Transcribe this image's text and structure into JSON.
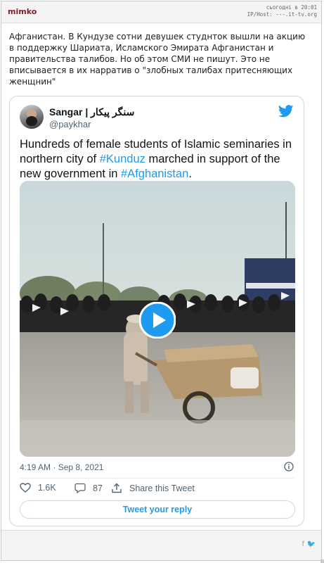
{
  "post": {
    "author": "mimko",
    "timestamp": "сьогодні в 20:01",
    "ip_host": "IP/Host: ---.it-tv.org",
    "text": "Афганистан. В Кундузе сотни девушек студнток вышли на акцию в поддержку Шариата, Исламского Эмирата Афганистан и правительства талибов. Но об этом СМИ не пишут. Это не вписывается в их нарратив о \"злобных талибах притесняющих женщнин\""
  },
  "tweet": {
    "name": "Sangar | سنگر پیکار",
    "handle": "@paykhar",
    "text_part1": "Hundreds of female students of Islamic seminaries in northern city of ",
    "hashtag1": "#Kunduz",
    "text_part2": " marched in support of the new government in ",
    "hashtag2": "#Afghanistan",
    "text_part3": ".",
    "time": "4:19 AM · Sep 8, 2021",
    "likes": "1.6K",
    "replies": "87",
    "share_label": "Share this Tweet",
    "reply_button": "Tweet your reply"
  },
  "footer": {
    "share_icons": [
      "facebook-icon",
      "twitter-icon"
    ],
    "facebook": "f",
    "twitter": "🐦"
  },
  "colors": {
    "author": "#7b1f2b",
    "twitter_blue": "#1d9bf0",
    "text_secondary": "#536471"
  }
}
